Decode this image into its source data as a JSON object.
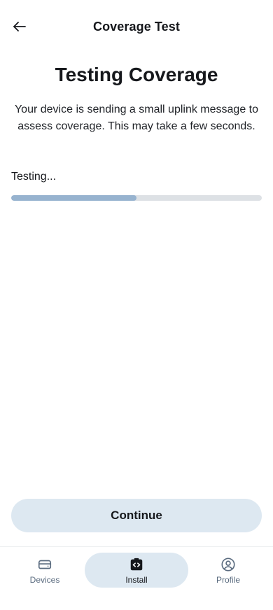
{
  "header": {
    "title": "Coverage Test",
    "back_icon": "arrow-left-icon"
  },
  "main": {
    "title": "Testing Coverage",
    "description": "Your device is sending a small uplink message to assess coverage. This may take a few seconds.",
    "status": "Testing...",
    "progress_fraction": 0.5
  },
  "actions": {
    "continue_label": "Continue"
  },
  "bottom_nav": {
    "items": [
      {
        "label": "Devices",
        "icon": "device-icon",
        "active": false
      },
      {
        "label": "Install",
        "icon": "install-icon",
        "active": true
      },
      {
        "label": "Profile",
        "icon": "profile-icon",
        "active": false
      }
    ]
  },
  "colors": {
    "progress_fill": "#97b3cf",
    "progress_track": "#dde1e5",
    "button_bg": "#dde8f1",
    "nav_active_bg": "#dde8f1",
    "nav_inactive_text": "#5a6b7f"
  }
}
